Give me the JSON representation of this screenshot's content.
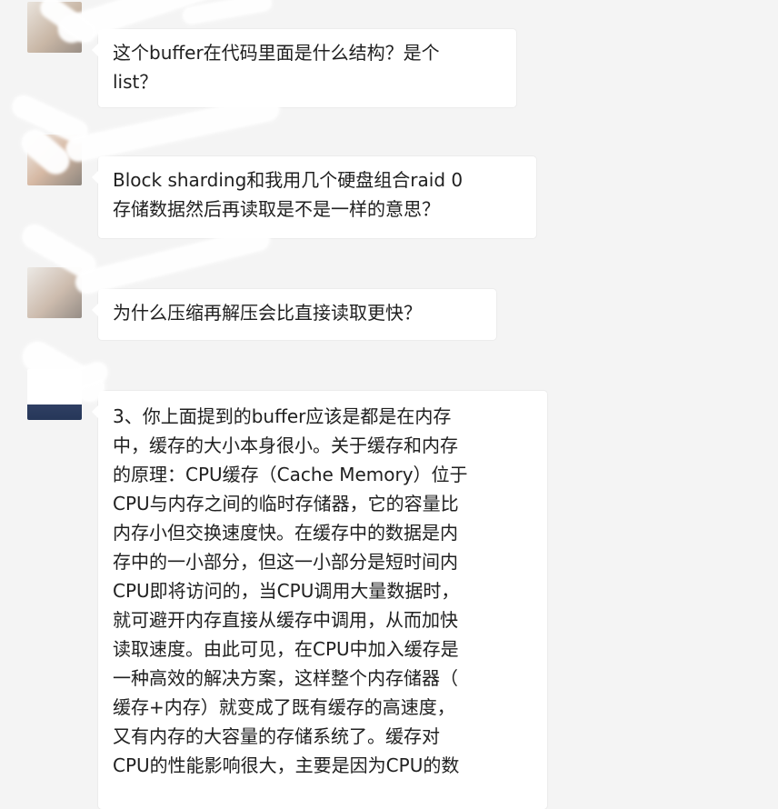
{
  "chat": {
    "messages": [
      {
        "sender": "",
        "text": "这个buffer在代码里面是什么结构？是个\nlist？"
      },
      {
        "sender": "",
        "text": "Block sharding和我用几个硬盘组合raid 0\n存储数据然后再读取是不是一样的意思？"
      },
      {
        "sender": "",
        "text": "为什么压缩再解压会比直接读取更快？"
      },
      {
        "sender": "",
        "text": "3、你上面提到的buffer应该是都是在内存\n中，缓存的大小本身很小。关于缓存和内存\n的原理：CPU缓存（Cache Memory）位于\nCPU与内存之间的临时存储器，它的容量比\n内存小但交换速度快。在缓存中的数据是内\n存中的一小部分，但这一小部分是短时间内\nCPU即将访问的，当CPU调用大量数据时，\n就可避开内存直接从缓存中调用，从而加快\n读取速度。由此可见，在CPU中加入缓存是\n一种高效的解决方案，这样整个内存储器（\n缓存+内存）就变成了既有缓存的高速度，\n又有内存的大容量的存储系统了。缓存对\nCPU的性能影响很大，主要是因为CPU的数"
      }
    ]
  }
}
